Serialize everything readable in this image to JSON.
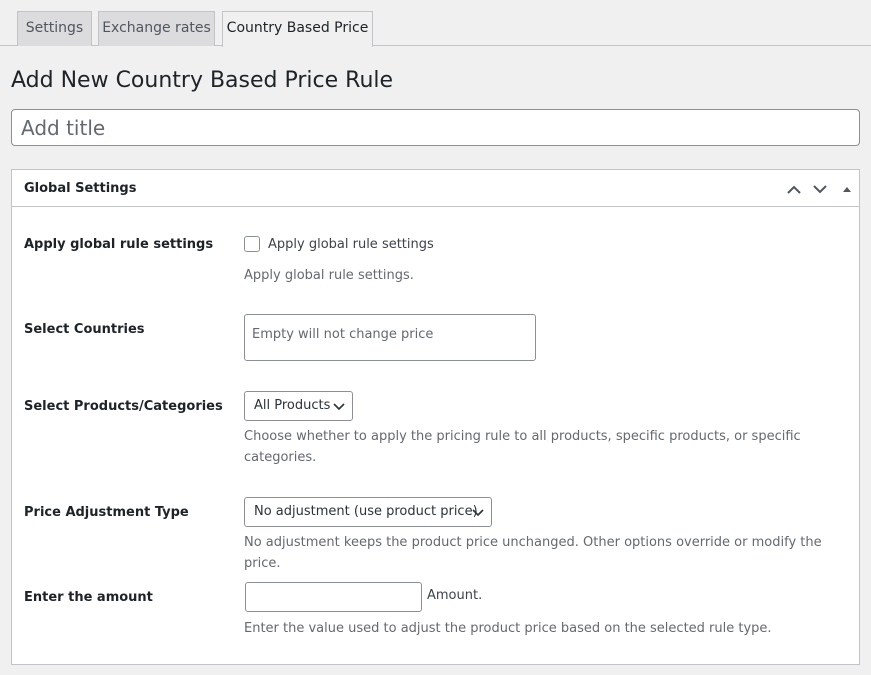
{
  "tabs": [
    {
      "label": "Settings",
      "active": false
    },
    {
      "label": "Exchange rates",
      "active": false
    },
    {
      "label": "Country Based Price",
      "active": true
    }
  ],
  "page": {
    "title": "Add New Country Based Price Rule",
    "title_placeholder": "Add title",
    "title_value": ""
  },
  "postbox": {
    "title": "Global Settings",
    "icons": [
      "chevron-up-icon",
      "chevron-down-icon",
      "triangle-up-icon"
    ]
  },
  "fields": {
    "global_rule": {
      "label": "Apply global rule settings",
      "checkbox_label": "Apply global rule settings",
      "checked": false,
      "description": "Apply global rule settings."
    },
    "countries": {
      "label": "Select Countries",
      "placeholder": "Empty will not change price"
    },
    "products": {
      "label": "Select Products/Categories",
      "selected": "All Products",
      "description_line1": "Choose whether to apply the pricing rule to all products, specific products, or specific",
      "description_line2": "categories."
    },
    "adjustment": {
      "label": "Price Adjustment Type",
      "selected": "No adjustment (use product price)",
      "description": "No adjustment keeps the product price unchanged. Other options override or modify the price."
    },
    "amount": {
      "label": "Enter the amount",
      "value": "",
      "suffix": "Amount.",
      "description": "Enter the value used to adjust the product price based on the selected rule type."
    }
  },
  "colors": {
    "background": "#f0f0f1",
    "border": "#c3c4c7",
    "text": "#1d2327",
    "muted": "#646970"
  }
}
